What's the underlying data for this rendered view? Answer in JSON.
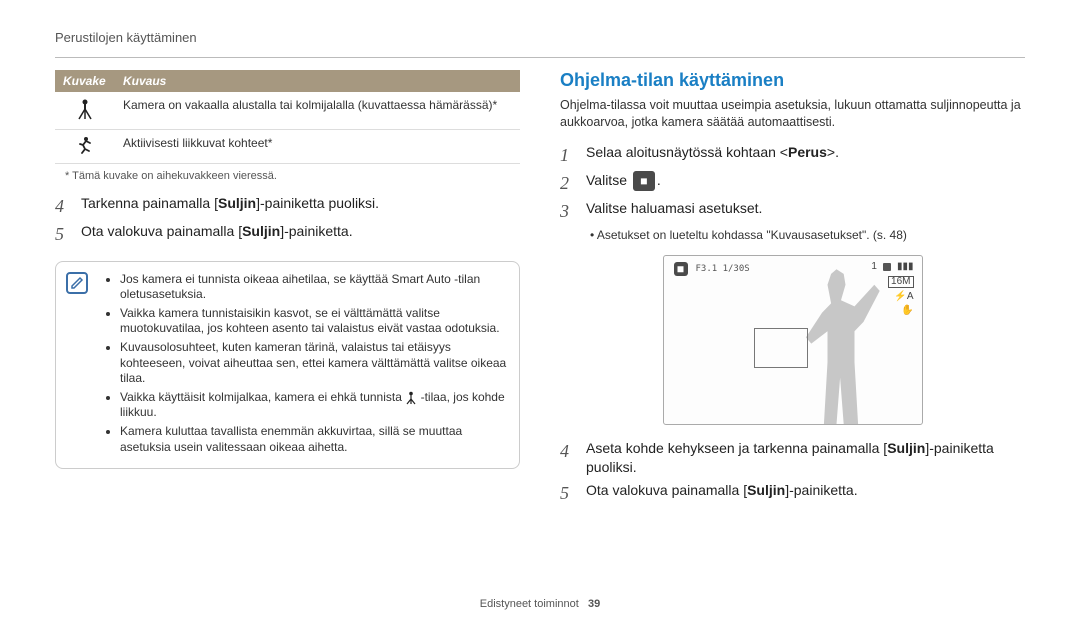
{
  "breadcrumb": "Perustilojen käyttäminen",
  "table": {
    "headers": {
      "icon": "Kuvake",
      "desc": "Kuvaus"
    },
    "rows": [
      {
        "desc": "Kamera on vakaalla alustalla tai kolmijalalla (kuvattaessa hämärässä)*"
      },
      {
        "desc": "Aktiivisesti liikkuvat kohteet*"
      }
    ]
  },
  "footnote": "* Tämä kuvake on aihekuvakkeen vieressä.",
  "left_steps": {
    "s4_pre": "Tarkenna painamalla [",
    "s4_strong": "Suljin",
    "s4_post": "]-painiketta puoliksi.",
    "s5_pre": "Ota valokuva painamalla [",
    "s5_strong": "Suljin",
    "s5_post": "]-painiketta."
  },
  "info_box": {
    "items": [
      "Jos kamera ei tunnista oikeaa aihetilaa, se käyttää Smart Auto -tilan oletusasetuksia.",
      "Vaikka kamera tunnistaisikin kasvot, se ei välttämättä valitse muotokuvatilaa, jos kohteen asento tai valaistus eivät vastaa odotuksia.",
      "Kuvausolosuhteet, kuten kameran tärinä, valaistus tai etäisyys kohteeseen, voivat aiheuttaa sen, ettei kamera välttämättä valitse oikeaa tilaa.",
      "Vaikka käyttäisit kolmijalkaa, kamera ei ehkä tunnista -tilaa, jos kohde liikkuu.",
      "Kamera kuluttaa tavallista enemmän akkuvirtaa, sillä se muuttaa asetuksia usein valitessaan oikeaa aihetta."
    ]
  },
  "right": {
    "heading": "Ohjelma-tilan käyttäminen",
    "intro": "Ohjelma-tilassa voit muuttaa useimpia asetuksia, lukuun ottamatta suljinnopeutta ja aukkoarvoa, jotka kamera säätää automaattisesti.",
    "steps": {
      "s1_pre": "Selaa aloitusnäytössä kohtaan <",
      "s1_strong": "Perus",
      "s1_post": ">.",
      "s2": "Valitse",
      "s3": "Valitse haluamasi asetukset.",
      "s3_sub": "• Asetukset on lueteltu kohdassa \"Kuvausasetukset\". (s. 48)",
      "s4_pre": "Aseta kohde kehykseen ja tarkenna painamalla [",
      "s4_strong": "Suljin",
      "s4_post": "]-painiketta puoliksi.",
      "s5_pre": "Ota valokuva painamalla [",
      "s5_strong": "Suljin",
      "s5_post": "]-painiketta."
    }
  },
  "screen": {
    "readout": "F3.1  1/30S",
    "count": "1",
    "battery": "▮▮▮",
    "res": "16M",
    "flash": "⚡A",
    "stab": "✋"
  },
  "footer": {
    "label": "Edistyneet toiminnot",
    "page": "39"
  }
}
